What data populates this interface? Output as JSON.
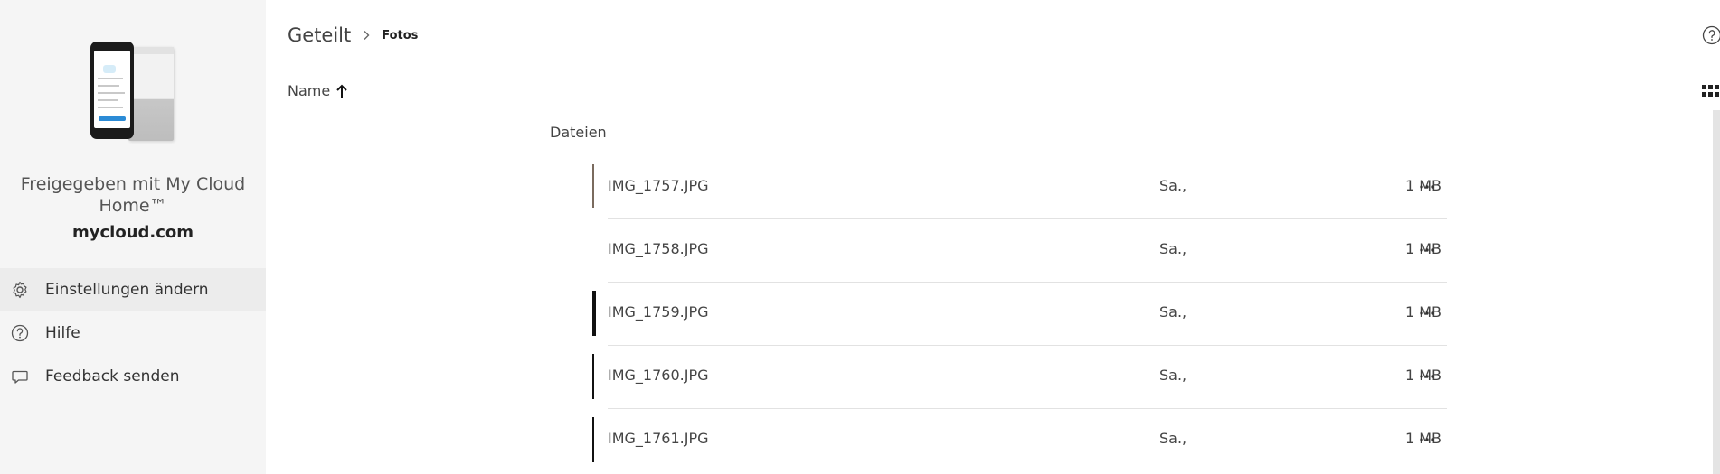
{
  "sidebar": {
    "shared_text": "Freigegeben mit My Cloud Home™",
    "domain": "mycloud.com",
    "menu": [
      {
        "label": "Einstellungen ändern",
        "icon": "gear-icon"
      },
      {
        "label": "Hilfe",
        "icon": "help-icon"
      },
      {
        "label": "Feedback senden",
        "icon": "feedback-icon"
      }
    ]
  },
  "header": {
    "breadcrumb_root": "Geteilt",
    "breadcrumb_current": "Fotos"
  },
  "sort": {
    "label": "Name"
  },
  "section": {
    "label": "Dateien"
  },
  "files": [
    {
      "name": "IMG_1757.JPG",
      "date": "Sa.,",
      "size": "1 MB"
    },
    {
      "name": "IMG_1758.JPG",
      "date": "Sa.,",
      "size": "1 MB"
    },
    {
      "name": "IMG_1759.JPG",
      "date": "Sa.,",
      "size": "1 MB"
    },
    {
      "name": "IMG_1760.JPG",
      "date": "Sa.,",
      "size": "1 MB"
    },
    {
      "name": "IMG_1761.JPG",
      "date": "Sa.,",
      "size": "1 MB"
    }
  ],
  "colors": {
    "sidebar_bg": "#f5f5f5",
    "active_menu_bg": "#ececec",
    "divider": "#e2e2e2"
  }
}
